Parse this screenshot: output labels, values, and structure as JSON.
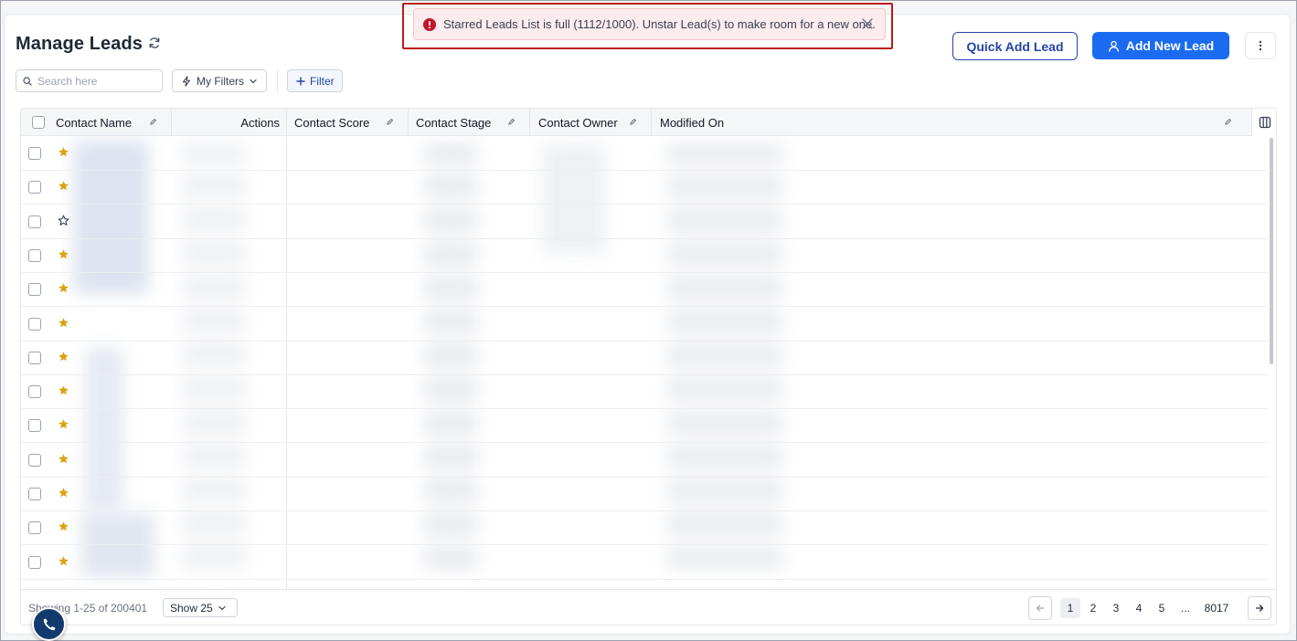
{
  "page": {
    "title": "Manage Leads"
  },
  "toast": {
    "message": "Starred Leads List is full (1112/1000). Unstar Lead(s) to make room for a new one."
  },
  "header": {
    "quick_add_label": "Quick Add Lead",
    "add_new_label": "Add New Lead"
  },
  "toolbar": {
    "search_placeholder": "Search here",
    "my_filters_label": "My Filters",
    "filter_label": "Filter"
  },
  "table": {
    "columns": [
      "Contact Name",
      "Actions",
      "Contact Score",
      "Contact Stage",
      "Contact Owner",
      "Modified On"
    ],
    "rows": [
      {
        "starred": true
      },
      {
        "starred": true
      },
      {
        "starred": false
      },
      {
        "starred": true
      },
      {
        "starred": true
      },
      {
        "starred": true
      },
      {
        "starred": true
      },
      {
        "starred": true
      },
      {
        "starred": true
      },
      {
        "starred": true
      },
      {
        "starred": true
      },
      {
        "starred": true
      },
      {
        "starred": true
      }
    ]
  },
  "footer": {
    "showing_text": "Showing 1-25 of 200401",
    "page_size_label": "Show 25",
    "pages": [
      "1",
      "2",
      "3",
      "4",
      "5"
    ],
    "ellipsis": "...",
    "last_page": "8017",
    "current_page": "1"
  },
  "colors": {
    "primary": "#1a6bf0",
    "outline_button": "#2545a8",
    "error": "#c0162e",
    "star": "#d9a514",
    "highlight_outline": "#b91c1c",
    "fab": "#133a6e"
  },
  "icons": {
    "refresh": "refresh-icon",
    "error": "error-icon",
    "close": "close-icon",
    "user_add": "user-add-icon",
    "more": "more-vertical-icon",
    "search": "search-icon",
    "bolt": "bolt-icon",
    "plus": "plus-icon",
    "edit": "edit-icon",
    "columns": "columns-icon",
    "star": "star-icon",
    "phone": "phone-icon"
  }
}
